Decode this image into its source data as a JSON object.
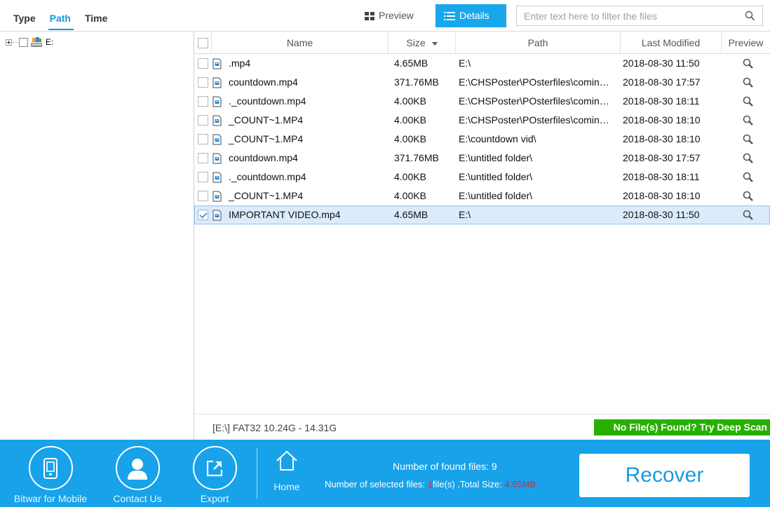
{
  "tabs": [
    {
      "label": "Type",
      "active": false
    },
    {
      "label": "Path",
      "active": true
    },
    {
      "label": "Time",
      "active": false
    }
  ],
  "view": {
    "preview_label": "Preview",
    "details_label": "Details",
    "active": "details"
  },
  "search": {
    "placeholder": "Enter text here to filter the files",
    "value": ""
  },
  "tree": {
    "root_label": "E:",
    "icons": [
      "expand-icon",
      "checkbox",
      "drive-icon"
    ]
  },
  "table": {
    "columns": {
      "name": "Name",
      "size": "Size",
      "path": "Path",
      "modified": "Last Modified",
      "preview": "Preview"
    },
    "sort": {
      "column": "size",
      "direction": "descending"
    },
    "rows": [
      {
        "name": ".mp4",
        "size": "4.65MB",
        "path": "E:\\",
        "modified": "2018-08-30  11:50",
        "checked": false
      },
      {
        "name": "countdown.mp4",
        "size": "371.76MB",
        "path": "E:\\CHSPoster\\POsterfiles\\comin…",
        "modified": "2018-08-30  17:57",
        "checked": false
      },
      {
        "name": "._countdown.mp4",
        "size": "4.00KB",
        "path": "E:\\CHSPoster\\POsterfiles\\comin…",
        "modified": "2018-08-30  18:11",
        "checked": false
      },
      {
        "name": "_COUNT~1.MP4",
        "size": "4.00KB",
        "path": "E:\\CHSPoster\\POsterfiles\\comin…",
        "modified": "2018-08-30  18:10",
        "checked": false
      },
      {
        "name": "_COUNT~1.MP4",
        "size": "4.00KB",
        "path": "E:\\countdown vid\\",
        "modified": "2018-08-30  18:10",
        "checked": false
      },
      {
        "name": "countdown.mp4",
        "size": "371.76MB",
        "path": "E:\\untitled folder\\",
        "modified": "2018-08-30  17:57",
        "checked": false
      },
      {
        "name": "._countdown.mp4",
        "size": "4.00KB",
        "path": "E:\\untitled folder\\",
        "modified": "2018-08-30  18:11",
        "checked": false
      },
      {
        "name": "_COUNT~1.MP4",
        "size": "4.00KB",
        "path": "E:\\untitled folder\\",
        "modified": "2018-08-30  18:10",
        "checked": false
      },
      {
        "name": "IMPORTANT VIDEO.mp4",
        "size": "4.65MB",
        "path": "E:\\",
        "modified": "2018-08-30  11:50",
        "checked": true
      }
    ]
  },
  "status": {
    "drive_info": "[E:\\] FAT32 10.24G - 14.31G",
    "deep_scan_label": "No File(s) Found? Try Deep Scan"
  },
  "bottom": {
    "mobile_label": "Bitwar for Mobile",
    "contact_label": "Contact Us",
    "export_label": "Export",
    "home_label": "Home",
    "found_text": "Number of found files: 9",
    "selected_prefix": "Number of selected files: ",
    "selected_count": "1",
    "selected_mid": "file(s) ,Total Size: ",
    "selected_size": "4.65MB",
    "recover_label": "Recover"
  },
  "colors": {
    "accent": "#18a7ea",
    "bottom_bar": "#17a2e9",
    "deep_scan": "#27b000",
    "highlight_red": "#d9263a",
    "selected_row": "#dcebfc"
  }
}
